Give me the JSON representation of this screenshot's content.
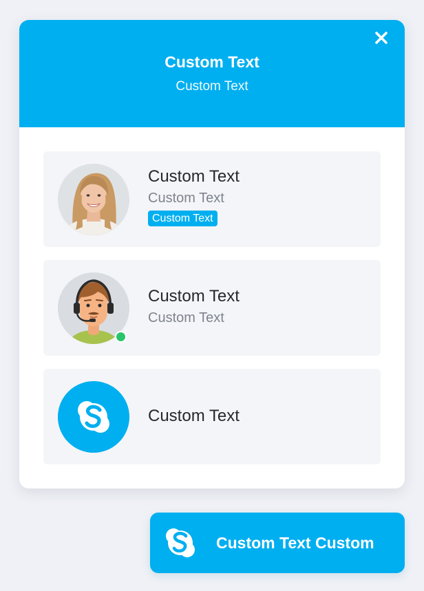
{
  "colors": {
    "accent": "#00aff0",
    "background": "#eff1f6",
    "card_background": "#f4f5f8",
    "online_status": "#2ac46b"
  },
  "header": {
    "title": "Custom Text",
    "subtitle": "Custom Text",
    "close_icon": "close-icon"
  },
  "agents": [
    {
      "name": "Custom Text",
      "role": "Custom Text",
      "badge": "Custom Text",
      "avatar_icon": "woman-avatar-photo"
    },
    {
      "name": "Custom Text",
      "role": "Custom Text",
      "avatar_icon": "support-agent-headset-avatar",
      "status": "online"
    },
    {
      "name": "Custom Text",
      "avatar_icon": "skype-icon"
    }
  ],
  "launcher": {
    "label": "Custom Text Custom",
    "icon": "skype-icon"
  }
}
